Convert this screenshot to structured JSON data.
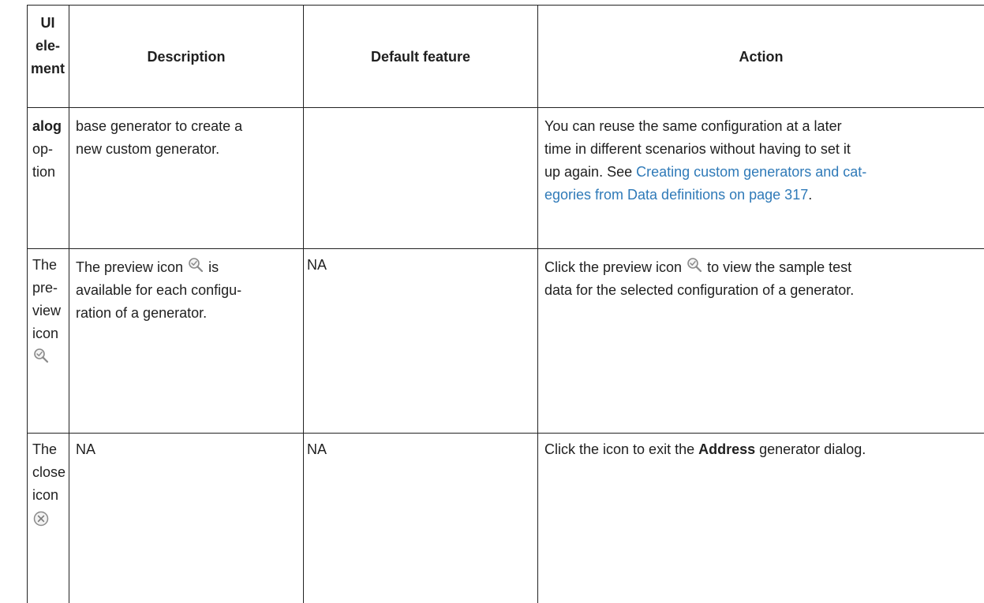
{
  "table": {
    "headers": {
      "ui_element": [
        "UI",
        "ele-",
        "ment"
      ],
      "description": "Description",
      "default_feature": "Default feature",
      "action": "Action"
    },
    "rows": [
      {
        "ui_element": [
          "alog",
          "op-",
          "tion"
        ],
        "ui_element_bold_first": true,
        "description": [
          "base generator to create a",
          "new custom generator."
        ],
        "default_feature": "",
        "action": {
          "lines": [
            "You can reuse the same configuration at a later",
            "time in different scenarios without having to set it",
            "up again. See "
          ],
          "link_part1": "Creating custom generators and cat-",
          "link_part2": "egories from Data definitions on page 317",
          "tail": "."
        }
      },
      {
        "ui_element": [
          "The",
          "pre-",
          "view",
          "icon"
        ],
        "description": {
          "line1_prefix": "The preview icon ",
          "line1_suffix": " is",
          "line2": "available for each configu-",
          "line3": "ration of a generator."
        },
        "default_feature": "NA",
        "action": {
          "line1_prefix": "Click the preview icon ",
          "line1_suffix": " to view the sample test",
          "line2": "data for the selected configuration of a generator."
        }
      },
      {
        "ui_element": [
          "The",
          "close",
          "icon"
        ],
        "description": "NA",
        "default_feature": "NA",
        "action": {
          "prefix": "Click the icon to exit the ",
          "bold": "Address",
          "suffix": " generator dialog."
        }
      }
    ]
  },
  "icons": {
    "preview": "magnifier-check-icon",
    "close": "close-circle-icon"
  },
  "colors": {
    "link": "#2f7ab8",
    "border": "#222222",
    "text": "#1f1f1f"
  }
}
